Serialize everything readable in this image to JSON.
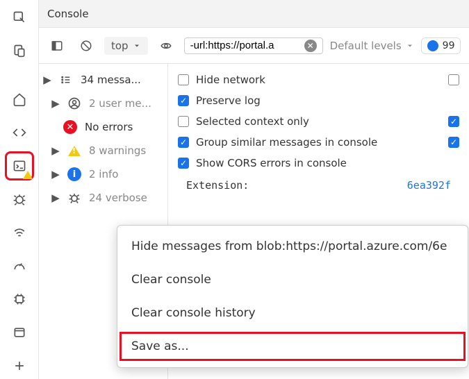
{
  "title": "Console",
  "toolbar": {
    "context": "top",
    "filter_value": "-url:https://portal.a",
    "levels_label": "Default levels",
    "issues_count": "99"
  },
  "sidebar": {
    "items": [
      {
        "icon": "list",
        "label": "34 messa...",
        "dark": true,
        "nested": false,
        "disclosure": true
      },
      {
        "icon": "user-circle",
        "label": "2 user me...",
        "dark": false,
        "nested": true,
        "disclosure": true
      },
      {
        "icon": "error-red",
        "label": "No errors",
        "dark": true,
        "nested": false,
        "disclosure": false
      },
      {
        "icon": "warn-tri",
        "label": "8 warnings",
        "dark": false,
        "nested": true,
        "disclosure": true
      },
      {
        "icon": "info-blue",
        "label": "2 info",
        "dark": false,
        "nested": true,
        "disclosure": true
      },
      {
        "icon": "bug",
        "label": "24 verbose",
        "dark": false,
        "nested": true,
        "disclosure": true
      }
    ]
  },
  "settings": {
    "items": [
      {
        "label": "Hide network",
        "checked": false,
        "right_cb": true
      },
      {
        "label": "Preserve log",
        "checked": true,
        "right_cb": false
      },
      {
        "label": "Selected context only",
        "checked": false,
        "right_cb": true,
        "right_checked": true
      },
      {
        "label": "Group similar messages in console",
        "checked": true,
        "right_cb": true,
        "right_checked": true
      },
      {
        "label": "Show CORS errors in console",
        "checked": true,
        "right_cb": false
      }
    ],
    "extension_label": "Extension:",
    "extension_id": "6ea392f"
  },
  "context_menu": {
    "items": [
      "Hide messages from blob:https://portal.azure.com/6e",
      "Clear console",
      "Clear console history",
      "Save as..."
    ]
  }
}
